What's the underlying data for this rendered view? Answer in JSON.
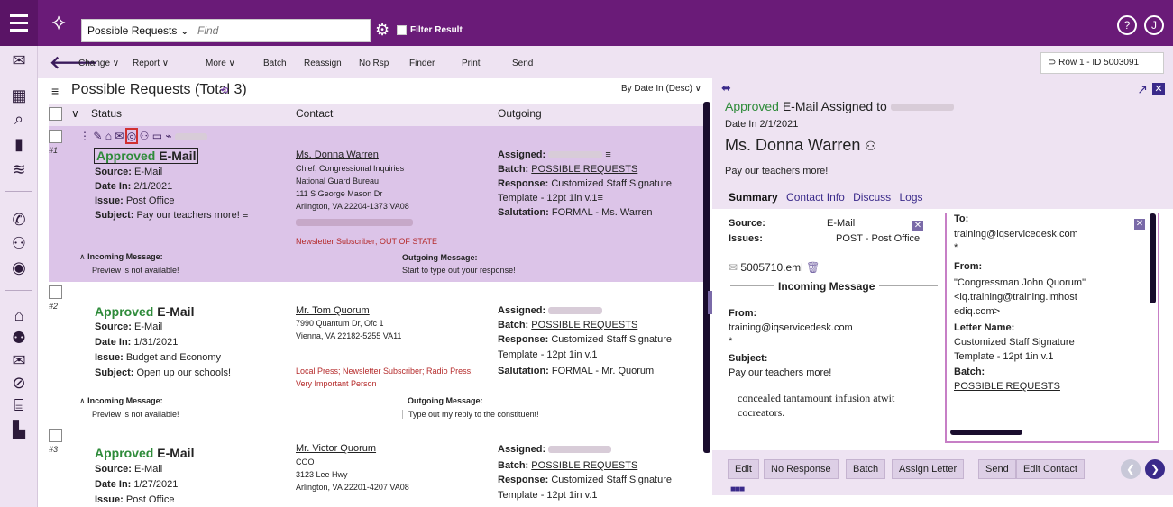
{
  "header": {
    "view_select": "Possible Requests",
    "find_placeholder": "Find",
    "filter_label": "Filter Result",
    "help_icon": "?",
    "user_initial": "J"
  },
  "toolbar": {
    "change": "Change ∨",
    "report": "Report ∨",
    "more": "More ∨",
    "batch": "Batch",
    "reassign": "Reassign",
    "no_rsp": "No Rsp",
    "finder": "Finder",
    "print": "Print",
    "send": "Send",
    "row_id": "Row 1 - ID 5003091"
  },
  "list": {
    "title": "Possible Requests (Total 3)",
    "sort": "By Date In (Desc) ∨",
    "columns": [
      "Status",
      "Contact",
      "Outgoing"
    ],
    "rows": [
      {
        "num": "#1",
        "approved": "Approved",
        "email": "E-Mail",
        "source": "E-Mail",
        "date_in": "2/1/2021",
        "issue": "Post Office",
        "subject": "Pay our teachers more!",
        "contact_name": "Ms. Donna Warren",
        "contact_lines": [
          "Chief, Congressional Inquiries",
          "National Guard Bureau",
          "111 S George Mason Dr",
          "Arlington, VA 22204-1373  VA08"
        ],
        "contact_tags": "Newsletter Subscriber; OUT OF STATE",
        "batch": "POSSIBLE REQUESTS",
        "response": "Customized Staff Signature",
        "template": "Template - 12pt 1in v.1",
        "salutation": "FORMAL - Ms. Warren",
        "incoming_label": "Incoming Message:",
        "incoming_text": "Preview is not available!",
        "outgoing_label": "Outgoing Message:",
        "outgoing_text": "Start to type out your response!"
      },
      {
        "num": "#2",
        "approved": "Approved",
        "email": "E-Mail",
        "source": "E-Mail",
        "date_in": "1/31/2021",
        "issue": "Budget and Economy",
        "subject": "Open up our schools!",
        "contact_name": "Mr. Tom Quorum",
        "contact_lines": [
          "7990 Quantum Dr, Ofc 1",
          "Vienna, VA 22182-5255  VA11"
        ],
        "contact_tags": "Local Press; Newsletter Subscriber; Radio Press;",
        "contact_tags2": "Very Important Person",
        "batch": "POSSIBLE REQUESTS",
        "response": "Customized Staff Signature",
        "template": "Template - 12pt 1in v.1",
        "salutation": "FORMAL - Mr. Quorum",
        "incoming_label": "Incoming Message:",
        "incoming_text": "Preview is not available!",
        "outgoing_label": "Outgoing Message:",
        "outgoing_text": "Type out my reply to the constituent!"
      },
      {
        "num": "#3",
        "approved": "Approved",
        "email": "E-Mail",
        "source": "E-Mail",
        "date_in": "1/27/2021",
        "issue": "Post Office",
        "contact_name": "Mr. Victor Quorum",
        "contact_lines": [
          "COO",
          "3123 Lee Hwy",
          "Arlington, VA 22201-4207  VA08"
        ],
        "batch": "POSSIBLE REQUESTS",
        "response": "Customized Staff Signature",
        "template": "Template - 12pt 1in v.1"
      }
    ],
    "labels": {
      "source": "Source:",
      "date_in": "Date In:",
      "issue": "Issue:",
      "subject": "Subject:",
      "assigned": "Assigned:",
      "batch": "Batch:",
      "response": "Response:",
      "salutation": "Salutation:"
    }
  },
  "detail": {
    "title_approved": "Approved",
    "title_rest": "E-Mail Assigned to",
    "date_in": "Date In 2/1/2021",
    "name": "Ms. Donna Warren",
    "subject_line": "Pay our teachers more!",
    "tabs": [
      "Summary",
      "Contact Info",
      "Discuss",
      "Logs"
    ],
    "source_label": "Source:",
    "source_value": "E-Mail",
    "issues_label": "Issues:",
    "issues_value": "POST - Post Office",
    "attachment": "5005710.eml",
    "incoming_header": "Incoming Message",
    "from_label": "From:",
    "from_value": "training@iqservicedesk.com",
    "star": "*",
    "subject_label": "Subject:",
    "subject_value": "Pay our teachers more!",
    "body": "concealed tantamount infusion atwit",
    "body2": "cocreators.",
    "right": {
      "to_label": "To:",
      "to_value": "training@iqservicedesk.com",
      "star": "*",
      "from_label": "From:",
      "from_line1": "\"Congressman John Quorum\"",
      "from_line2": "<iq.training@training.lmhost",
      "from_line3": "ediq.com>",
      "letter_label": "Letter Name:",
      "letter_line1": "Customized Staff Signature",
      "letter_line2": "Template - 12pt 1in v.1",
      "batch_label": "Batch:",
      "batch_value": "POSSIBLE REQUESTS"
    },
    "actions": [
      "Edit",
      "No Response",
      "Batch",
      "Assign Letter",
      "Send",
      "Edit Contact"
    ]
  }
}
